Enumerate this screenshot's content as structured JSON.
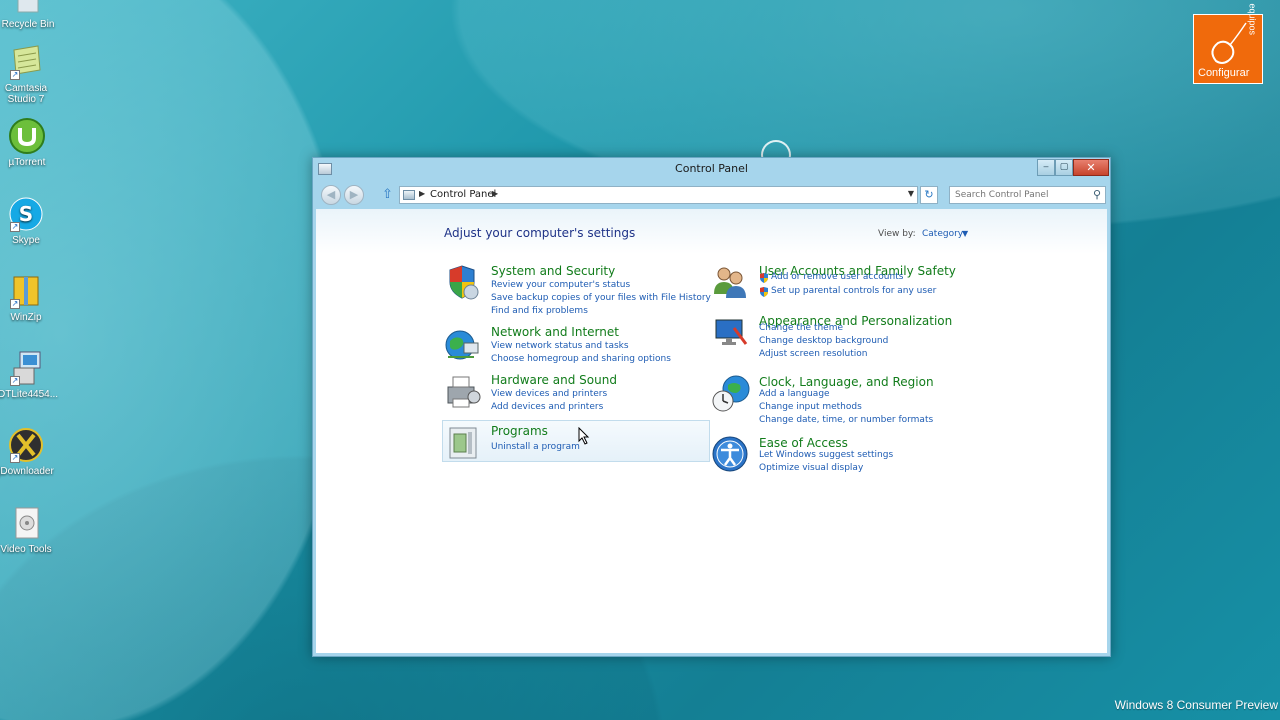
{
  "desktop": {
    "icons": [
      {
        "label": "Recycle Bin",
        "icon": "recycle-bin-icon"
      },
      {
        "label": "Camtasia Studio 7",
        "icon": "camtasia-icon"
      },
      {
        "label": "µTorrent",
        "icon": "utorrent-icon"
      },
      {
        "label": "Skype",
        "icon": "skype-icon"
      },
      {
        "label": "WinZip",
        "icon": "winzip-icon"
      },
      {
        "label": "DTLite4454...",
        "icon": "daemon-tools-installer-icon"
      },
      {
        "label": "jDownloader",
        "icon": "jdownloader-icon"
      },
      {
        "label": "Video Tools",
        "icon": "video-tools-icon"
      }
    ],
    "watermark": "Windows 8 Consumer Preview",
    "logo": {
      "text": "Configurar",
      "side_text": "equipos",
      "color": "#f06a0c"
    }
  },
  "window": {
    "title": "Control Panel",
    "buttons": {
      "minimize": "‒",
      "maximize": "▢",
      "close": "✕"
    },
    "address": {
      "crumbs": [
        "Control Panel"
      ]
    },
    "search": {
      "placeholder": "Search Control Panel"
    }
  },
  "content": {
    "heading": "Adjust your computer's settings",
    "view_by_label": "View by:",
    "view_by_value": "Category",
    "categories_left": [
      {
        "title": "System and Security",
        "links": [
          "Review your computer's status",
          "Save backup copies of your files with File History",
          "Find and fix problems"
        ]
      },
      {
        "title": "Network and Internet",
        "links": [
          "View network status and tasks",
          "Choose homegroup and sharing options"
        ]
      },
      {
        "title": "Hardware and Sound",
        "links": [
          "View devices and printers",
          "Add devices and printers"
        ]
      },
      {
        "title": "Programs",
        "links": [
          "Uninstall a program"
        ]
      }
    ],
    "categories_right": [
      {
        "title": "User Accounts and Family Safety",
        "links": [
          "Add or remove user accounts",
          "Set up parental controls for any user"
        ]
      },
      {
        "title": "Appearance and Personalization",
        "links": [
          "Change the theme",
          "Change desktop background",
          "Adjust screen resolution"
        ]
      },
      {
        "title": "Clock, Language, and Region",
        "links": [
          "Add a language",
          "Change input methods",
          "Change date, time, or number formats"
        ]
      },
      {
        "title": "Ease of Access",
        "links": [
          "Let Windows suggest settings",
          "Optimize visual display"
        ]
      }
    ]
  },
  "colors": {
    "category_title": "#127c1b",
    "link": "#1e5cb3",
    "heading": "#1e3287",
    "window_frame": "#a6d5ec"
  }
}
